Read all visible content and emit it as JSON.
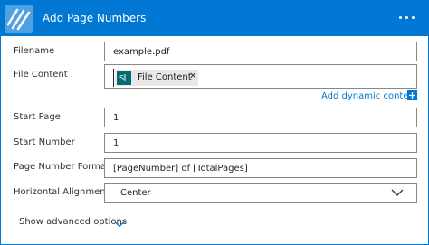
{
  "header": {
    "title": "Add Page Numbers",
    "logo_icon": "diagonal-stripes-logo-icon",
    "more_icon": "more-options-ellipsis-icon"
  },
  "fields": {
    "filename": {
      "label": "Filename",
      "value": "example.pdf"
    },
    "file_content": {
      "label": "File Content",
      "token_label": "File Content",
      "token_icon": "sharepoint-icon",
      "remove_icon": "close-icon"
    },
    "add_dynamic_content": "Add dynamic content",
    "start_page": {
      "label": "Start Page",
      "value": "1"
    },
    "start_number": {
      "label": "Start Number",
      "value": "1"
    },
    "page_number_format": {
      "label": "Page Number Format",
      "value": "[PageNumber] of [TotalPages]"
    },
    "horizontal_alignment": {
      "label": "Horizontal Alignment",
      "value": "Center"
    }
  },
  "footer": {
    "advanced_label": "Show advanced options"
  },
  "colors": {
    "accent": "#0078d4",
    "token_icon": "#036c70",
    "border": "#8a8886"
  }
}
